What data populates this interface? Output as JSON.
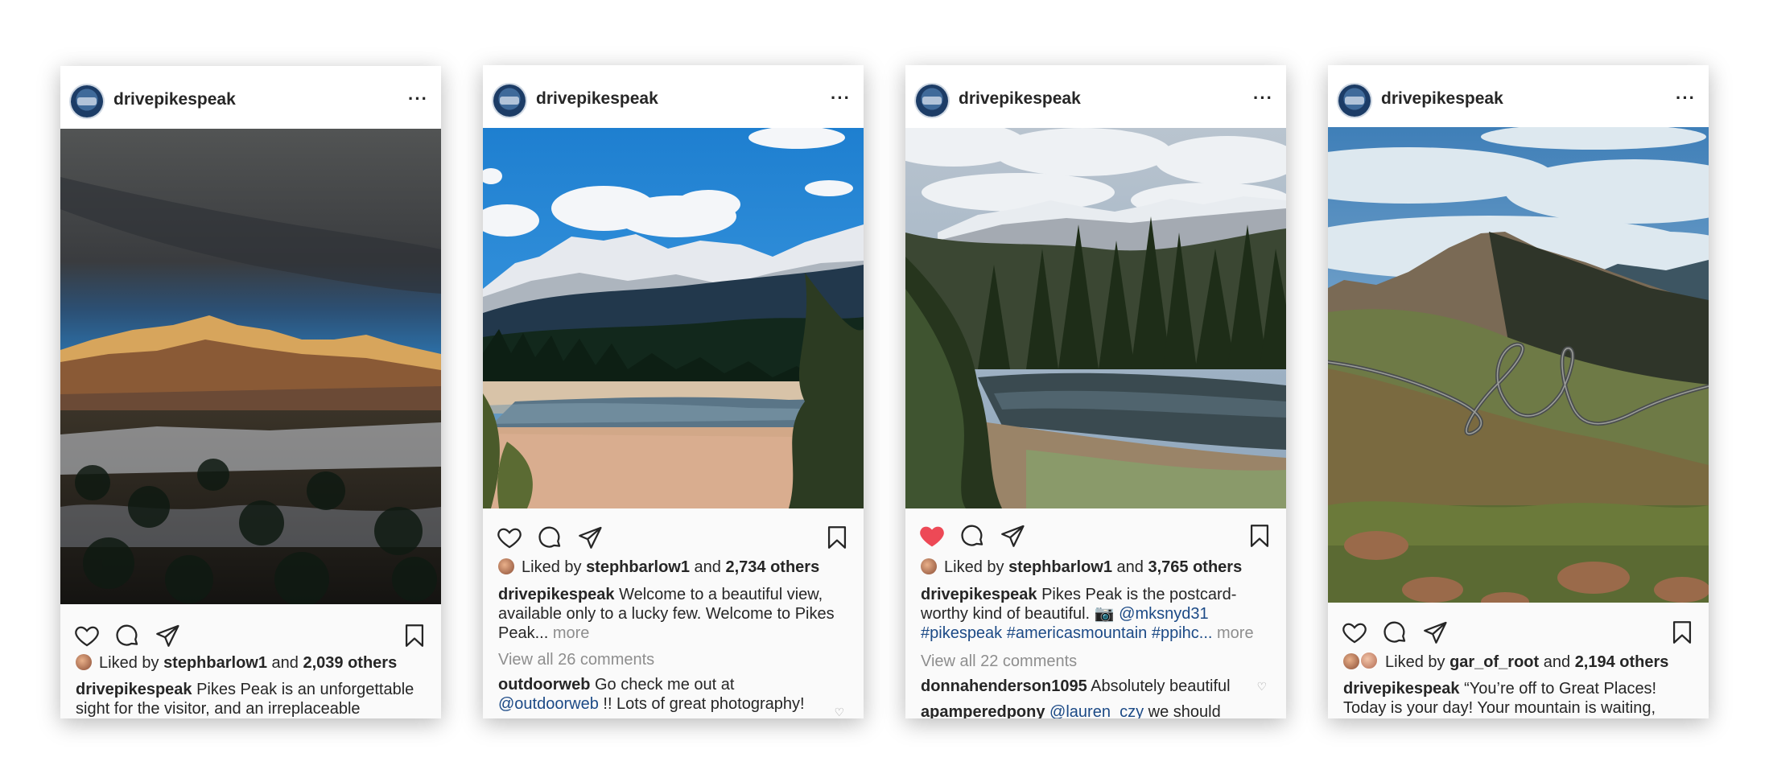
{
  "posts": [
    {
      "username": "drivepikespeak",
      "more_icon": "···",
      "liked_by_user": "stephbarlow1",
      "liked_by_and": "and",
      "liked_by_others": "2,039 others",
      "liked_by_prefix": "Liked by",
      "caption_user": "drivepikespeak",
      "caption_line1": "Pikes Peak is an unforgettable",
      "caption_line2": "sight for the visitor, and an irreplaceable",
      "liked": false
    },
    {
      "username": "drivepikespeak",
      "more_icon": "···",
      "liked_by_prefix": "Liked by",
      "liked_by_user": "stephbarlow1",
      "liked_by_and": "and",
      "liked_by_others": "2,734 others",
      "caption_user": "drivepikespeak",
      "caption_line1": "Welcome to a beautiful view,",
      "caption_line2": "available only to a lucky few. Welcome to Pikes",
      "caption_line3": "Peak...",
      "caption_more": "more",
      "view_comments": "View all 26 comments",
      "comment_user": "outdoorweb",
      "comment_line1": "Go check me out at",
      "comment_mention": "@outdoorweb",
      "comment_line2": "!! Lots of great photography!",
      "liked": false
    },
    {
      "username": "drivepikespeak",
      "more_icon": "···",
      "liked_by_prefix": "Liked by",
      "liked_by_user": "stephbarlow1",
      "liked_by_and": "and",
      "liked_by_others": "3,765 others",
      "caption_user": "drivepikespeak",
      "caption_line1": "Pikes Peak is the postcard-",
      "caption_line2": "worthy kind of beautiful. 📷",
      "caption_mention": "@mksnyd31",
      "caption_tags": "#pikespeak #americasmountain #ppihc...",
      "caption_more": "more",
      "view_comments": "View all 22 comments",
      "comment1_user": "donnahenderson1095",
      "comment1_text": "Absolutely beautiful",
      "comment2_user": "apamperedpony",
      "comment2_mention": "@lauren_czy",
      "comment2_text": "we should",
      "liked": true
    },
    {
      "username": "drivepikespeak",
      "more_icon": "···",
      "liked_by_prefix": "Liked by",
      "liked_by_user": "gar_of_root",
      "liked_by_and": "and",
      "liked_by_others": "2,194 others",
      "caption_user": "drivepikespeak",
      "caption_line1": "“You’re off to Great Places!",
      "caption_line2": "Today is your day! Your mountain is waiting,",
      "liked": false
    }
  ],
  "colors": {
    "background": "#ffffff",
    "card": "#fafafa",
    "text": "#262626",
    "muted": "#8e8e8e",
    "link": "#1c4a86",
    "like_red": "#ed4956"
  },
  "icons": [
    "heart-icon",
    "comment-icon",
    "share-icon",
    "bookmark-icon",
    "more-icon"
  ]
}
